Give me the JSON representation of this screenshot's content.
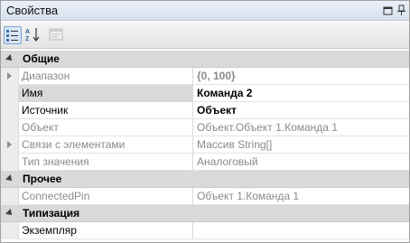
{
  "window": {
    "title": "Свойства"
  },
  "toolbar": {
    "categorized_icon": "categorized-icon",
    "alphabetical_icon": "sort-alpha-icon",
    "property_pages_icon": "property-pages-icon"
  },
  "categories": [
    {
      "label": "Общие",
      "rows": [
        {
          "name": "Диапазон",
          "value": "{0, 100}"
        },
        {
          "name": "Имя",
          "value": "Команда 2"
        },
        {
          "name": "Источник",
          "value": "Объект"
        },
        {
          "name": "Объект",
          "value": "Объект.Объект 1.Команда 1"
        },
        {
          "name": "Связи с элементами",
          "value": "Массив String[]"
        },
        {
          "name": "Тип значения",
          "value": "Аналоговый"
        }
      ]
    },
    {
      "label": "Прочее",
      "rows": [
        {
          "name": "ConnectedPin",
          "value": "Объект 1.Команда 1"
        }
      ]
    },
    {
      "label": "Типизация",
      "rows": [
        {
          "name": "Экземпляр",
          "value": ""
        }
      ]
    }
  ]
}
